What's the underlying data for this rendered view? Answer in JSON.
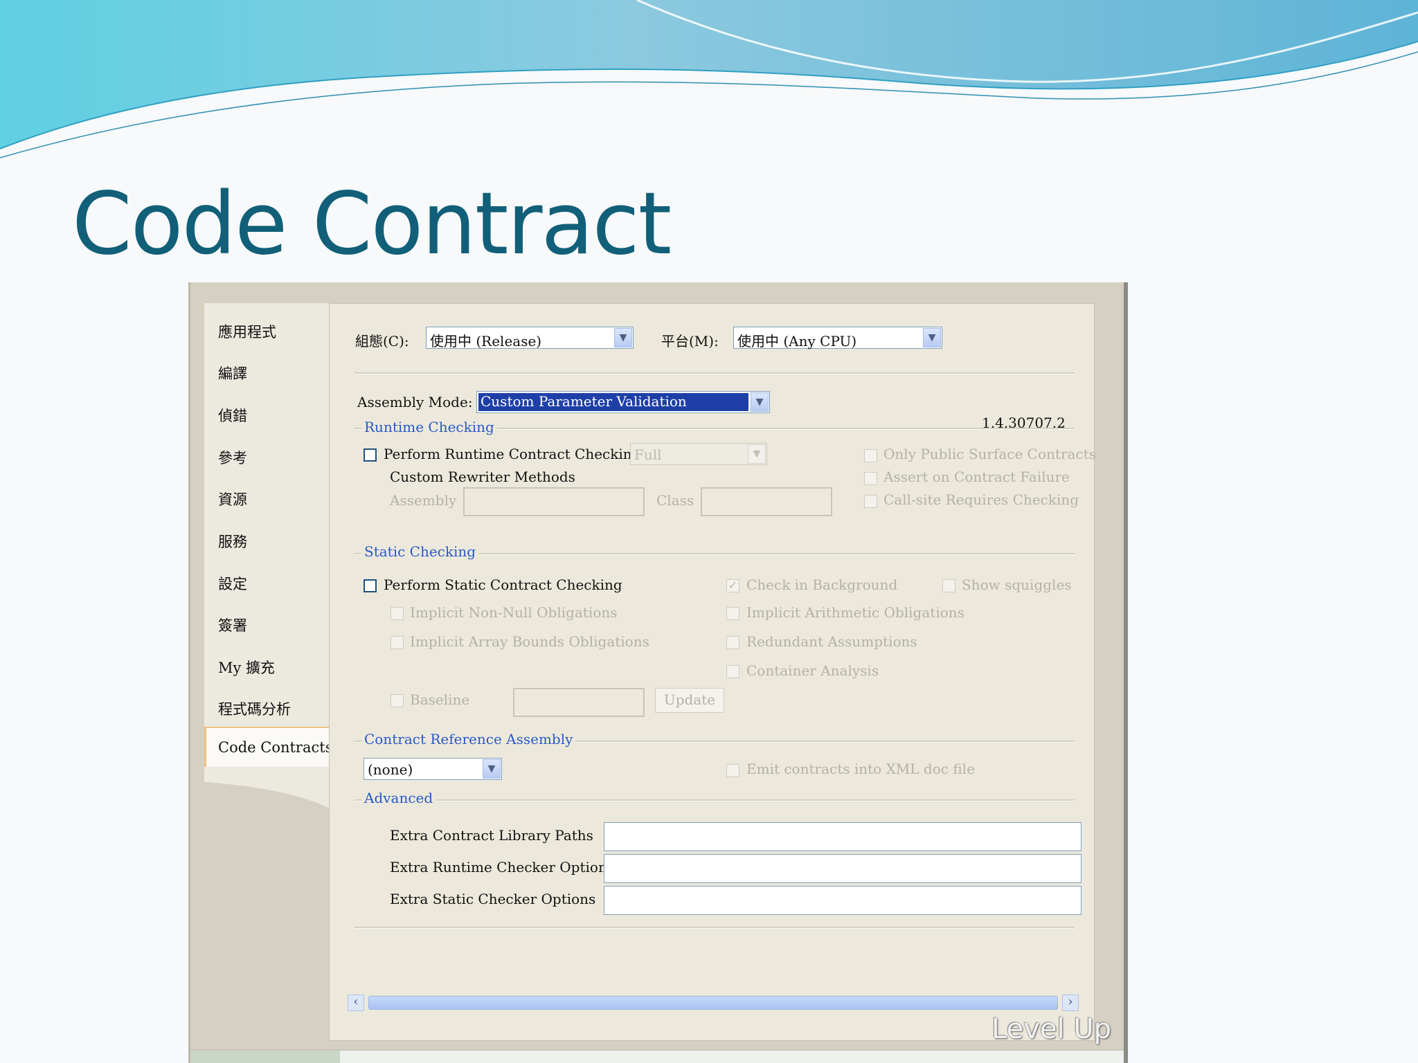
{
  "slide": {
    "title": "Code Contract"
  },
  "nav": {
    "items": [
      {
        "label": "應用程式"
      },
      {
        "label": "編譯"
      },
      {
        "label": "偵錯"
      },
      {
        "label": "參考"
      },
      {
        "label": "資源"
      },
      {
        "label": "服務"
      },
      {
        "label": "設定"
      },
      {
        "label": "簽署"
      },
      {
        "label": "My 擴充"
      },
      {
        "label": "程式碼分析"
      },
      {
        "label": "Code Contracts",
        "active": true
      }
    ]
  },
  "config": {
    "configuration_label": "組態(C):",
    "configuration_value": "使用中 (Release)",
    "platform_label": "平台(M):",
    "platform_value": "使用中 (Any CPU)"
  },
  "assembly_mode": {
    "label": "Assembly Mode:",
    "value": "Custom Parameter Validation"
  },
  "version": "1.4.30707.2",
  "runtime_checking": {
    "group_label": "Runtime Checking",
    "perform_label": "Perform Runtime Contract Checking",
    "level_value": "Full",
    "rewriter_label": "Custom Rewriter Methods",
    "assembly_label": "Assembly",
    "class_label": "Class",
    "only_public_label": "Only Public Surface Contracts",
    "assert_label": "Assert on Contract Failure",
    "callsite_label": "Call-site Requires Checking"
  },
  "static_checking": {
    "group_label": "Static Checking",
    "perform_label": "Perform Static Contract Checking",
    "background_label": "Check in Background",
    "squiggles_label": "Show squiggles",
    "nonnull_label": "Implicit Non-Null Obligations",
    "arithmetic_label": "Implicit Arithmetic Obligations",
    "array_label": "Implicit Array Bounds Obligations",
    "redundant_label": "Redundant Assumptions",
    "container_label": "Container Analysis",
    "baseline_label": "Baseline",
    "update_label": "Update"
  },
  "reference_assembly": {
    "group_label": "Contract Reference Assembly",
    "value": "(none)",
    "emit_label": "Emit contracts into XML doc file"
  },
  "advanced": {
    "group_label": "Advanced",
    "library_paths_label": "Extra Contract Library Paths",
    "runtime_options_label": "Extra Runtime Checker Options",
    "static_options_label": "Extra Static Checker Options"
  },
  "scrollbar": {
    "left_icon": "chevron-left-icon",
    "right_icon": "chevron-right-icon"
  },
  "watermark": "Level Up",
  "colors": {
    "title": "#115f78",
    "group_label": "#2a58c8",
    "selection": "#1e3fa8"
  }
}
